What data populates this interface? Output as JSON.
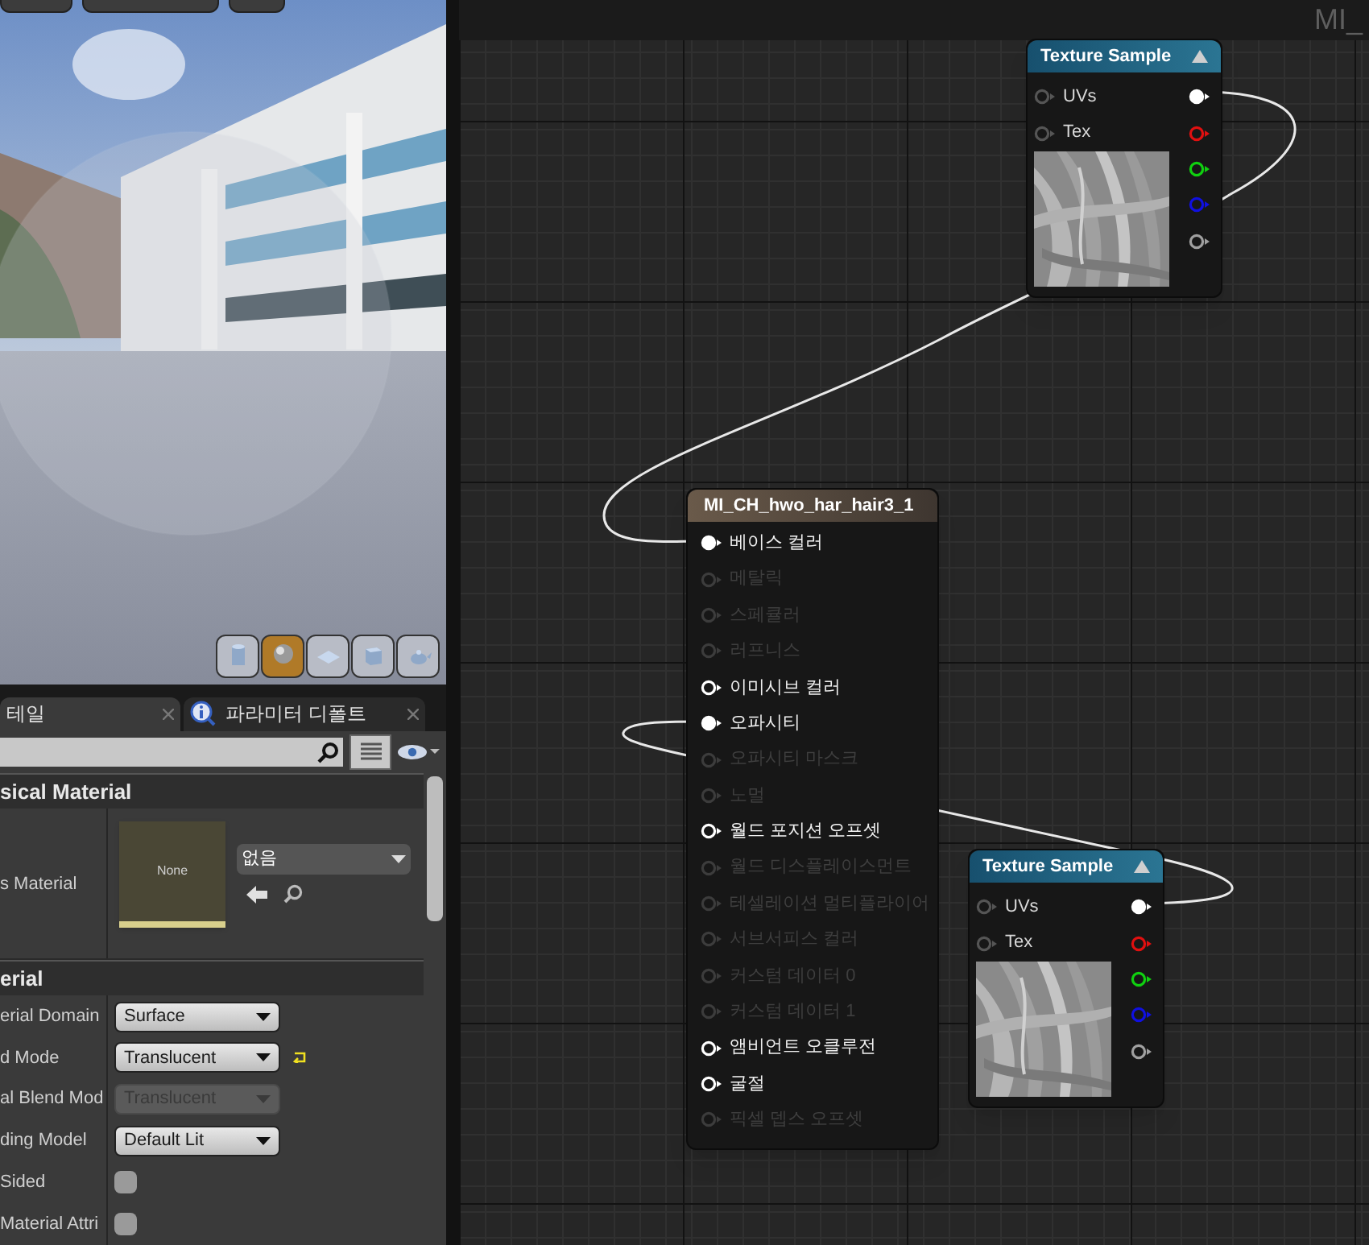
{
  "viewport": {
    "preview_shapes": [
      {
        "kind": "cylinder",
        "selected": false
      },
      {
        "kind": "sphere",
        "selected": true
      },
      {
        "kind": "plane",
        "selected": false
      },
      {
        "kind": "cube",
        "selected": false
      },
      {
        "kind": "teapot",
        "selected": false
      }
    ]
  },
  "details": {
    "tabs": [
      {
        "label": "테일",
        "kind": "plain",
        "selected": true
      },
      {
        "label": "파라미터 디폴트",
        "kind": "info",
        "selected": false
      }
    ],
    "sections": [
      {
        "title": "sical Material",
        "rows": [
          {
            "kind": "asset",
            "label": "s Material",
            "thumbnail": "None",
            "value": "없음"
          }
        ]
      },
      {
        "title": "erial",
        "rows": [
          {
            "kind": "dropdown",
            "label": "erial Domain",
            "value": "Surface",
            "disabled": false,
            "modified": false
          },
          {
            "kind": "dropdown",
            "label": "d Mode",
            "value": "Translucent",
            "disabled": false,
            "modified": true
          },
          {
            "kind": "dropdown",
            "label": "al Blend Mod",
            "value": "Translucent",
            "disabled": true,
            "modified": false
          },
          {
            "kind": "dropdown",
            "label": "ding Model",
            "value": "Default Lit",
            "disabled": false,
            "modified": false
          },
          {
            "kind": "checkbox",
            "label": "Sided",
            "checked": false
          },
          {
            "kind": "checkbox",
            "label": "Material Attri",
            "checked": false
          }
        ]
      }
    ]
  },
  "graph": {
    "title": "MI_",
    "texture_nodes": [
      {
        "title": "Texture Sample",
        "inputs": [
          "UVs",
          "Tex"
        ],
        "outputs": [
          {
            "color": "#ffffff",
            "connected": true
          },
          {
            "color": "#e01010",
            "connected": false
          },
          {
            "color": "#10d010",
            "connected": false
          },
          {
            "color": "#1010e0",
            "connected": false
          },
          {
            "color": "#a0a0a0",
            "connected": false
          }
        ]
      },
      {
        "title": "Texture Sample",
        "inputs": [
          "UVs",
          "Tex"
        ],
        "outputs": [
          {
            "color": "#ffffff",
            "connected": true
          },
          {
            "color": "#e01010",
            "connected": false
          },
          {
            "color": "#10d010",
            "connected": false
          },
          {
            "color": "#1010e0",
            "connected": false
          },
          {
            "color": "#a0a0a0",
            "connected": false
          }
        ]
      }
    ],
    "material_node": {
      "title": "MI_CH_hwo_har_hair3_1",
      "pins": [
        {
          "label": "베이스 컬러",
          "connected": true,
          "disabled": false
        },
        {
          "label": "메탈릭",
          "connected": false,
          "disabled": true
        },
        {
          "label": "스페큘러",
          "connected": false,
          "disabled": true
        },
        {
          "label": "러프니스",
          "connected": false,
          "disabled": true
        },
        {
          "label": "이미시브 컬러",
          "connected": false,
          "disabled": false
        },
        {
          "label": "오파시티",
          "connected": true,
          "disabled": false
        },
        {
          "label": "오파시티 마스크",
          "connected": false,
          "disabled": true
        },
        {
          "label": "노멀",
          "connected": false,
          "disabled": true
        },
        {
          "label": "월드 포지션 오프셋",
          "connected": false,
          "disabled": false
        },
        {
          "label": "월드 디스플레이스먼트",
          "connected": false,
          "disabled": true
        },
        {
          "label": "테셀레이션 멀티플라이어",
          "connected": false,
          "disabled": true
        },
        {
          "label": "서브서피스 컬러",
          "connected": false,
          "disabled": true
        },
        {
          "label": "커스텀 데이터 0",
          "connected": false,
          "disabled": true
        },
        {
          "label": "커스텀 데이터 1",
          "connected": false,
          "disabled": true
        },
        {
          "label": "앰비언트 오클루전",
          "connected": false,
          "disabled": false
        },
        {
          "label": "굴절",
          "connected": false,
          "disabled": false
        },
        {
          "label": "픽셀 뎁스 오프셋",
          "connected": false,
          "disabled": true
        }
      ]
    }
  }
}
